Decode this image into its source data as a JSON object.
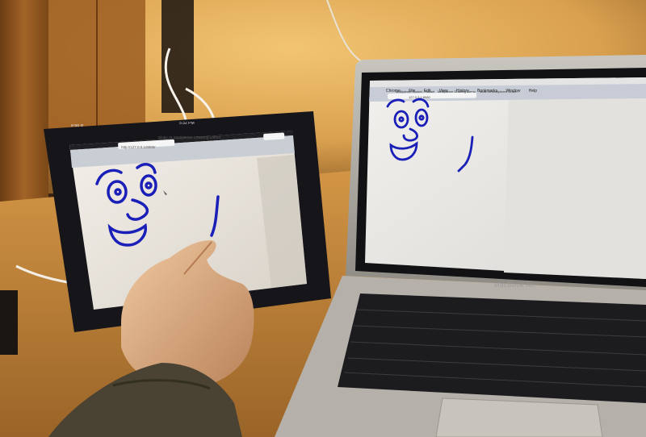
{
  "ipad": {
    "carrier": "iPad ≋",
    "time": "5:32 PM",
    "page_title": "Multi-Js Multiplexer Drawing Demo",
    "url": "http://127.0.0.1/8080/"
  },
  "laptop": {
    "brand": "MacBook Air",
    "menu": [
      "Chrome",
      "File",
      "Edit",
      "View",
      "History",
      "Bookmarks",
      "Window",
      "Help"
    ],
    "tabs": [
      "Multiplexer Socket - Socket",
      "Multiplexer Drawing Demo",
      "Multi-Js Multiplexer Drawi..."
    ],
    "url": "127.0.0.1:8080"
  },
  "colors": {
    "ink": "#1a1fb8",
    "wall": "#e9b866",
    "desk": "#c98a3e"
  }
}
